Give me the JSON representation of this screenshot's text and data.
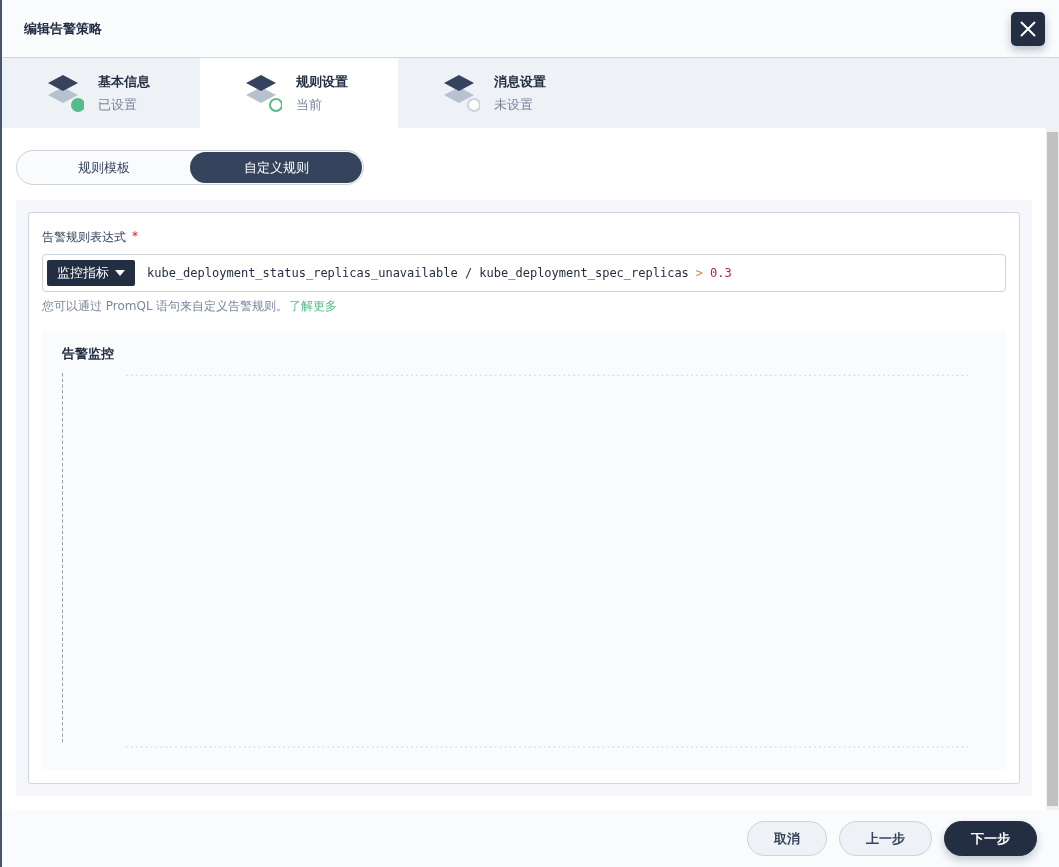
{
  "title": "编辑告警策略",
  "steps": [
    {
      "title": "基本信息",
      "status_text": "已设置",
      "kind": "done",
      "selected": false
    },
    {
      "title": "规则设置",
      "status_text": "当前",
      "kind": "current",
      "selected": true
    },
    {
      "title": "消息设置",
      "status_text": "未设置",
      "kind": "todo",
      "selected": false
    }
  ],
  "mode_tabs": [
    {
      "label": "规则模板",
      "selected": false
    },
    {
      "label": "自定义规则",
      "selected": true
    }
  ],
  "expression": {
    "label": "告警规则表达式",
    "required_mark": "*",
    "dropdown": "监控指标",
    "parts": [
      {
        "kind": "metric",
        "text": "kube_deployment_status_replicas_unavailable / kube_deployment_spec_replicas"
      },
      {
        "kind": "operator",
        "text": ">"
      },
      {
        "kind": "number",
        "text": "0.3"
      }
    ],
    "hint": "您可以通过 PromQL 语句来自定义告警规则。",
    "hint_link": "了解更多"
  },
  "monitor": {
    "title": "告警监控"
  },
  "buttons": [
    {
      "label": "取消",
      "kind": "secondary"
    },
    {
      "label": "上一步",
      "kind": "secondary"
    },
    {
      "label": "下一步",
      "kind": "primary"
    }
  ]
}
